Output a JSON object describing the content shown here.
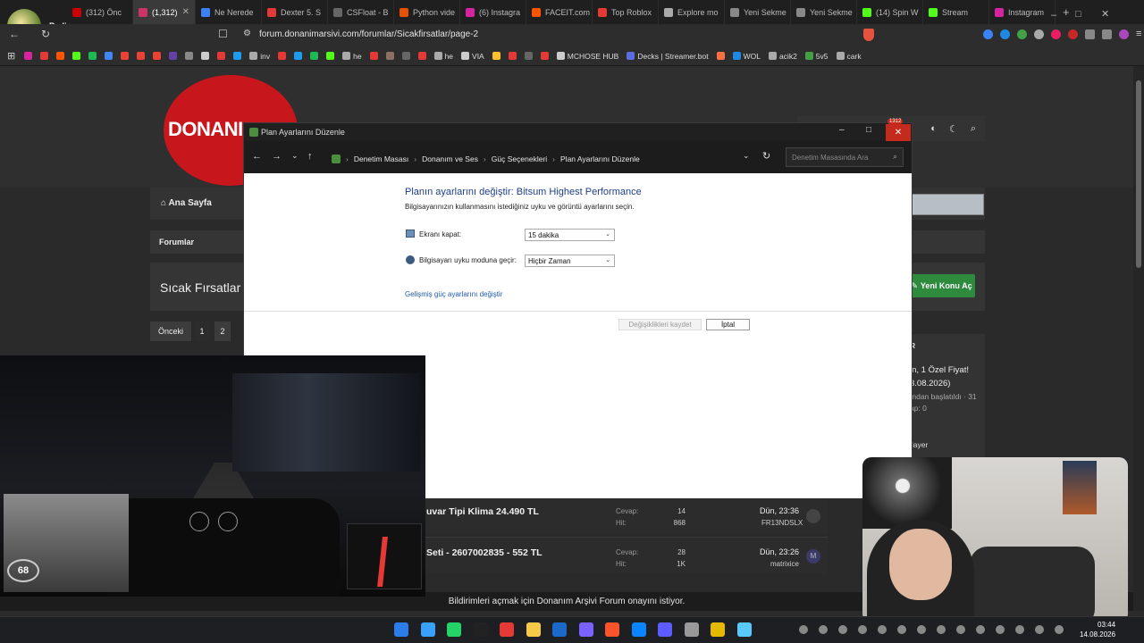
{
  "browser": {
    "tabs": [
      {
        "label": "(312) Önc",
        "color": "#cc0000"
      },
      {
        "label": "(1,312)",
        "color": "#cc3366",
        "active": true
      },
      {
        "label": "Ne Nerede",
        "color": "#3b82f6"
      },
      {
        "label": "Dexter 5. S",
        "color": "#e53935"
      },
      {
        "label": "CSFloat - B",
        "color": "#666"
      },
      {
        "label": "Python vide",
        "color": "#e65100"
      },
      {
        "label": "(6) Instagra",
        "color": "#d6249f"
      },
      {
        "label": "FACEIT.com",
        "color": "#ff5500"
      },
      {
        "label": "Top Roblox",
        "color": "#e53935"
      },
      {
        "label": "Explore mo",
        "color": "#aaa"
      },
      {
        "label": "Yeni Sekme",
        "color": "#888"
      },
      {
        "label": "Yeni Sekme",
        "color": "#888"
      },
      {
        "label": "(14) Spin W",
        "color": "#53fc18"
      },
      {
        "label": "Stream",
        "color": "#53fc18"
      },
      {
        "label": "Instagram",
        "color": "#d6249f"
      }
    ],
    "profile_name": "Bedi",
    "url": "forum.donanimarsivi.com/forumlar/Sicakfirsatlar/page-2",
    "bookmarks": [
      {
        "label": "",
        "color": "#d6249f"
      },
      {
        "label": "",
        "color": "#e53935"
      },
      {
        "label": "",
        "color": "#ff5500"
      },
      {
        "label": "",
        "color": "#53fc18"
      },
      {
        "label": "",
        "color": "#1db954"
      },
      {
        "label": "",
        "color": "#4285f4"
      },
      {
        "label": "",
        "color": "#ea4335"
      },
      {
        "label": "",
        "color": "#ea4335"
      },
      {
        "label": "",
        "color": "#ea4335"
      },
      {
        "label": "",
        "color": "#6441a5"
      },
      {
        "label": "",
        "color": "#888"
      },
      {
        "label": "",
        "color": "#ccc"
      },
      {
        "label": "",
        "color": "#e53935"
      },
      {
        "label": "",
        "color": "#1d9bf0"
      },
      {
        "label": "inv",
        "color": "#aaa"
      },
      {
        "label": "",
        "color": "#e53935"
      },
      {
        "label": "",
        "color": "#1d9bf0"
      },
      {
        "label": "",
        "color": "#1db954"
      },
      {
        "label": "",
        "color": "#53fc18"
      },
      {
        "label": "he",
        "color": "#aaa"
      },
      {
        "label": "",
        "color": "#e53935"
      },
      {
        "label": "",
        "color": "#8d6e63"
      },
      {
        "label": "",
        "color": "#666"
      },
      {
        "label": "",
        "color": "#e53935"
      },
      {
        "label": "he",
        "color": "#aaa"
      },
      {
        "label": "VIA",
        "color": "#ccc"
      },
      {
        "label": "",
        "color": "#fbc02d"
      },
      {
        "label": "",
        "color": "#e53935"
      },
      {
        "label": "",
        "color": "#666"
      },
      {
        "label": "",
        "color": "#e53935"
      },
      {
        "label": "MCHOSE HUB",
        "color": "#ccc"
      },
      {
        "label": "Decks | Streamer.bot",
        "color": "#5b6ee1"
      },
      {
        "label": "",
        "color": "#ff7043"
      },
      {
        "label": "WOL",
        "color": "#1e88e5"
      },
      {
        "label": "acik2",
        "color": "#aaa"
      },
      {
        "label": "5v5",
        "color": "#43a047"
      },
      {
        "label": "cark",
        "color": "#aaa"
      }
    ]
  },
  "page": {
    "logo_text": "DONANI",
    "home_label": "Ana Sayfa",
    "breadcrumb": "Forumlar",
    "section_title": "Sıcak Fırsatlar",
    "new_topic": "Yeni Konu Aç",
    "pager": {
      "prev": "Önceki",
      "p1": "1",
      "p2": "2"
    },
    "sidebar": {
      "letter": "R",
      "line1": "in, 1 Özel Fiyat!",
      "line2": "3.08.2026)",
      "line3": "ından başlatıldı · 31",
      "line4": "ap: 0",
      "line5": "ilayer"
    },
    "rows": [
      {
        "title": "uvar Tipi Klima 24.490 TL",
        "cevap_label": "Cevap:",
        "cevap": "14",
        "hit_label": "Hit:",
        "hit": "868",
        "date": "Dün, 23:36",
        "user": "FR13NDSLX"
      },
      {
        "title": "Seti - 2607002835 - 552 TL",
        "cevap_label": "Cevap:",
        "cevap": "28",
        "hit_label": "Hit:",
        "hit": "1K",
        "date": "Dün, 23:26",
        "user": "matrixice",
        "avatar": "M"
      }
    ],
    "notification": "Bildirimleri açmak için Donanım Arşivi Forum onayını istiyor."
  },
  "dialog": {
    "title": "Plan Ayarlarını Düzenle",
    "path": [
      "Denetim Masası",
      "Donanım ve Ses",
      "Güç Seçenekleri",
      "Plan Ayarlarını Düzenle"
    ],
    "search_placeholder": "Denetim Masasında Ara",
    "heading": "Planın ayarlarını değiştir: Bitsum Highest Performance",
    "subheading": "Bilgisayarınızın kullanmasını istediğiniz uyku ve görüntü ayarlarını seçin.",
    "screen_off_label": "Ekranı kapat:",
    "screen_off_value": "15 dakika",
    "sleep_label": "Bilgisayarı uyku moduna geçir:",
    "sleep_value": "Hiçbir Zaman",
    "advanced_link": "Gelişmiş güç ayarlarını değiştir",
    "save_label": "Değişiklikleri kaydet",
    "cancel_label": "İptal",
    "close_badge": "1312"
  },
  "overlay": {
    "speed": "68"
  },
  "taskbar": {
    "time": "03:44",
    "date": "14.08.2026"
  }
}
